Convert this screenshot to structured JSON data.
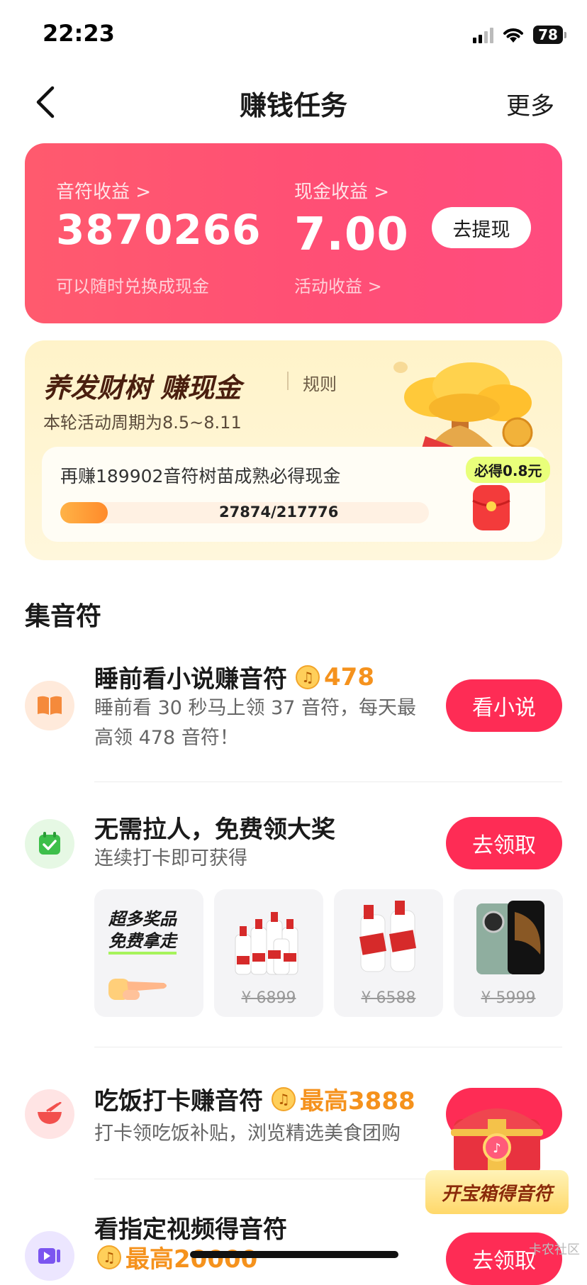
{
  "status": {
    "time": "22:23",
    "battery": "78"
  },
  "nav": {
    "title": "赚钱任务",
    "more": "更多"
  },
  "earnings": {
    "notes_label": "音符收益 >",
    "notes_value": "3870266",
    "notes_sub": "可以随时兑换成现金",
    "cash_label": "现金收益 >",
    "cash_value": "7.00",
    "cash_sub": "活动收益 >",
    "withdraw": "去提现"
  },
  "tree": {
    "title": "养发财树 赚现金",
    "rule": "规则",
    "period": "本轮活动周期为8.5~8.11",
    "message": "再赚189902音符树苗成熟必得现金",
    "progress_text": "27874/217776",
    "progress_fraction": 0.128,
    "reward": "必得0.8元"
  },
  "section_title": "集音符",
  "tasks": [
    {
      "title": "睡前看小说赚音符",
      "reward": "478",
      "desc": "睡前看 30 秒马上领 37 音符，每天最高领 478 音符！",
      "button": "看小说"
    },
    {
      "title": "无需拉人，免费领大奖",
      "desc": "连续打卡即可获得",
      "button": "去领取",
      "promo_line1": "超多奖品",
      "promo_line2": "免费拿走",
      "prices": [
        "¥ 6899",
        "¥ 6588",
        "¥ 5999"
      ]
    },
    {
      "title": "吃饭打卡赚音符",
      "reward": "最高3888",
      "desc": "打卡领吃饭补贴，浏览精选美食团购",
      "button": ""
    },
    {
      "title": "看指定视频得音符",
      "reward": "最高20000",
      "button": "去领取"
    }
  ],
  "chest_label": "开宝箱得音符",
  "watermark": "卡农社区",
  "colors": {
    "accent": "#fe2c55",
    "card_gradient": "#ff5a6e",
    "coin": "#f5921d"
  }
}
